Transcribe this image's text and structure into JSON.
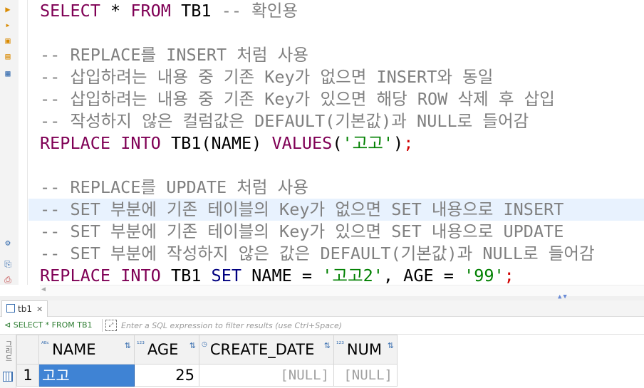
{
  "editor": {
    "lines": [
      {
        "tokens": [
          {
            "t": "kw",
            "v": "SELECT"
          },
          {
            "t": "op",
            "v": " * "
          },
          {
            "t": "kw",
            "v": "FROM"
          },
          {
            "t": "id",
            "v": " TB1 "
          },
          {
            "t": "cm",
            "v": "-- 확인용"
          }
        ]
      },
      {
        "tokens": []
      },
      {
        "tokens": [
          {
            "t": "cm",
            "v": "-- REPLACE를 INSERT 처럼 사용"
          }
        ]
      },
      {
        "tokens": [
          {
            "t": "cm",
            "v": "-- 삽입하려는 내용 중 기존 Key가 없으면 INSERT와 동일"
          }
        ]
      },
      {
        "tokens": [
          {
            "t": "cm",
            "v": "-- 삽입하려는 내용 중 기존 Key가 있으면 해당 ROW 삭제 후 삽입"
          }
        ]
      },
      {
        "tokens": [
          {
            "t": "cm",
            "v": "-- 작성하지 않은 컬럼값은 DEFAULT(기본값)과 NULL로 들어감"
          }
        ]
      },
      {
        "tokens": [
          {
            "t": "kw",
            "v": "REPLACE"
          },
          {
            "t": "id",
            "v": " "
          },
          {
            "t": "kw",
            "v": "INTO"
          },
          {
            "t": "id",
            "v": " TB1(NAME) "
          },
          {
            "t": "kw",
            "v": "VALUES"
          },
          {
            "t": "id",
            "v": "("
          },
          {
            "t": "str",
            "v": "'고고'"
          },
          {
            "t": "id",
            "v": ")"
          },
          {
            "t": "semi",
            "v": ";"
          }
        ]
      },
      {
        "tokens": []
      },
      {
        "tokens": [
          {
            "t": "cm",
            "v": "-- REPLACE를 UPDATE 처럼 사용"
          }
        ]
      },
      {
        "hl": true,
        "tokens": [
          {
            "t": "cm",
            "v": "-- SET 부분에 기존 테이블의 Key가 없으면 SET 내용으로 INSERT"
          }
        ]
      },
      {
        "tokens": [
          {
            "t": "cm",
            "v": "-- SET 부분에 기존 테이블의 Key가 있으면 SET 내용으로 UPDATE"
          }
        ]
      },
      {
        "tokens": [
          {
            "t": "cm",
            "v": "-- SET 부분에 작성하지 않은 값은 DEFAULT(기본값)과 NULL로 들어감"
          }
        ]
      },
      {
        "tokens": [
          {
            "t": "kw",
            "v": "REPLACE"
          },
          {
            "t": "id",
            "v": " "
          },
          {
            "t": "kw",
            "v": "INTO"
          },
          {
            "t": "id",
            "v": " TB1 "
          },
          {
            "t": "kwb",
            "v": "SET"
          },
          {
            "t": "id",
            "v": " NAME = "
          },
          {
            "t": "str",
            "v": "'고고2'"
          },
          {
            "t": "id",
            "v": ", AGE = "
          },
          {
            "t": "str",
            "v": "'99'"
          },
          {
            "t": "semi",
            "v": ";"
          }
        ]
      }
    ]
  },
  "results": {
    "tab_label": "tb1",
    "query_label": "SELECT * FROM TB1",
    "filter_placeholder": "Enter a SQL expression to filter results (use Ctrl+Space)",
    "side_label": "그리드",
    "columns": [
      {
        "name": "NAME",
        "type": "ABC"
      },
      {
        "name": "AGE",
        "type": "123"
      },
      {
        "name": "CREATE_DATE",
        "type": "clock"
      },
      {
        "name": "NUM",
        "type": "123"
      }
    ],
    "rows": [
      {
        "rownum": "1",
        "cells": [
          "고고",
          "25",
          "[NULL]",
          "[NULL]"
        ]
      }
    ]
  }
}
